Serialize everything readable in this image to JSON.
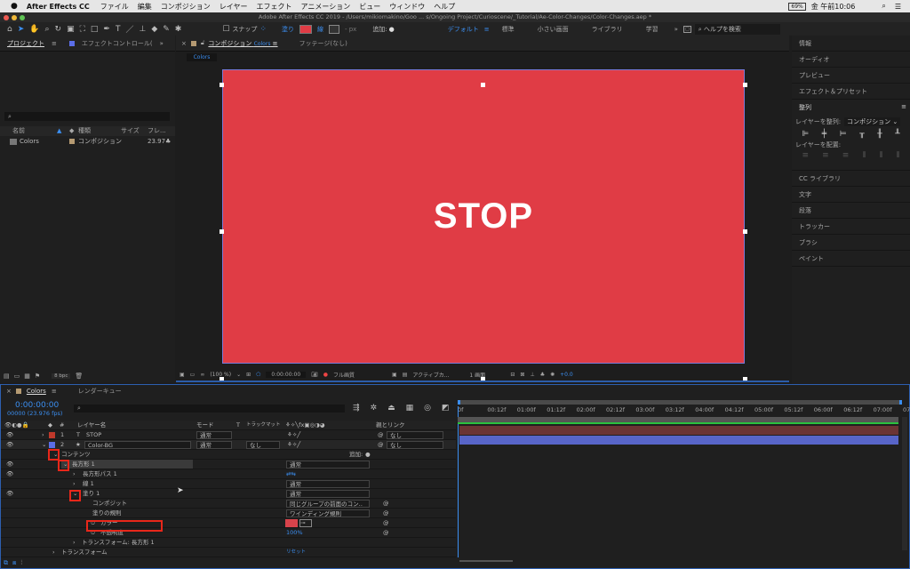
{
  "menubar": {
    "app": "After Effects CC",
    "items": [
      "ファイル",
      "編集",
      "コンポジション",
      "レイヤー",
      "エフェクト",
      "アニメーション",
      "ビュー",
      "ウィンドウ",
      "ヘルプ"
    ],
    "battery": "69%",
    "clock": "金 午前10:06"
  },
  "window_title": "Adobe After Effects CC 2019 - /Users/mikiomakino/Goo ... s/Ongoing Project/Curioscene/_Tutorial/Ae-Color-Changes/Color-Changes.aep *",
  "toolbar": {
    "snap": "スナップ",
    "fill": "塗り",
    "stroke": "線",
    "px": "- px",
    "add": "追加:",
    "workspaces": [
      "デフォルト",
      "標準",
      "小さい画面",
      "ライブラリ",
      "学習"
    ],
    "help_placeholder": "ヘルプを検索",
    "fill_color": "#e03c45"
  },
  "project": {
    "tab": "プロジェクト",
    "effects_tab": "エフェクトコントロール(",
    "columns": [
      "名前",
      "種類",
      "サイズ",
      "フレ..."
    ],
    "items": [
      {
        "name": "Colors",
        "type": "コンポジション",
        "fps": "23.97"
      }
    ],
    "bpc": "8 bpc"
  },
  "comp": {
    "tab": "コンポジション",
    "tab_name": "Colors",
    "footage_tab": "フッテージ(なし)",
    "breadcrumb": "Colors",
    "text": "STOP",
    "bg_color": "#e03c45",
    "footer": {
      "zoom": "(100 %)",
      "time": "0:00:00:00",
      "quality": "フル画質",
      "camera": "アクティブカ...",
      "views": "1 画面",
      "exposure": "+0.0"
    }
  },
  "right_panel": {
    "items_top": [
      "情報",
      "オーディオ",
      "プレビュー",
      "エフェクト＆プリセット"
    ],
    "align_title": "整列",
    "align_to_label": "レイヤーを整列:",
    "align_to_value": "コンポジション",
    "distribute_label": "レイヤーを配置:",
    "items_bottom": [
      "CC ライブラリ",
      "文字",
      "段落",
      "トラッカー",
      "ブラシ",
      "ペイント"
    ]
  },
  "timeline": {
    "tab": "Colors",
    "render_tab": "レンダーキュー",
    "timecode": "0:00:00:00",
    "frames": "00000 (23.976 fps)",
    "headers": {
      "layer_name": "レイヤー名",
      "mode": "モード",
      "t": "T",
      "trkmat": "トラックマット",
      "parent": "親とリンク"
    },
    "layers": [
      {
        "num": "1",
        "name": "STOP",
        "mode": "通常",
        "parent": "なし",
        "color": "#c0392b",
        "type": "T"
      },
      {
        "num": "2",
        "name": "Color-BG",
        "mode": "通常",
        "trkmat": "なし",
        "parent": "なし",
        "color": "#5b6ee8",
        "type": "★"
      }
    ],
    "props": {
      "contents": "コンテンツ",
      "add": "追加:",
      "rect": "長方形 1",
      "rect_mode": "通常",
      "rect_path": "長方形パス 1",
      "stroke": "線 1",
      "stroke_mode": "通常",
      "fill": "塗り 1",
      "fill_mode": "通常",
      "composite": "コンポジット",
      "composite_value": "同じグループの前面のコン‥",
      "fill_rule": "塗りの規則",
      "fill_rule_value": "ワインディング規則",
      "color": "カラー",
      "opacity": "不透明度",
      "opacity_value": "100%",
      "transform_rect": "トランスフォーム: 長方形 1",
      "transform": "トランスフォーム",
      "reset": "リセット"
    },
    "ruler": [
      "0f",
      "00:12f",
      "01:00f",
      "01:12f",
      "02:00f",
      "02:12f",
      "03:00f",
      "03:12f",
      "04:00f",
      "04:12f",
      "05:00f",
      "05:12f",
      "06:00f",
      "06:12f",
      "07:00f",
      "07"
    ]
  }
}
